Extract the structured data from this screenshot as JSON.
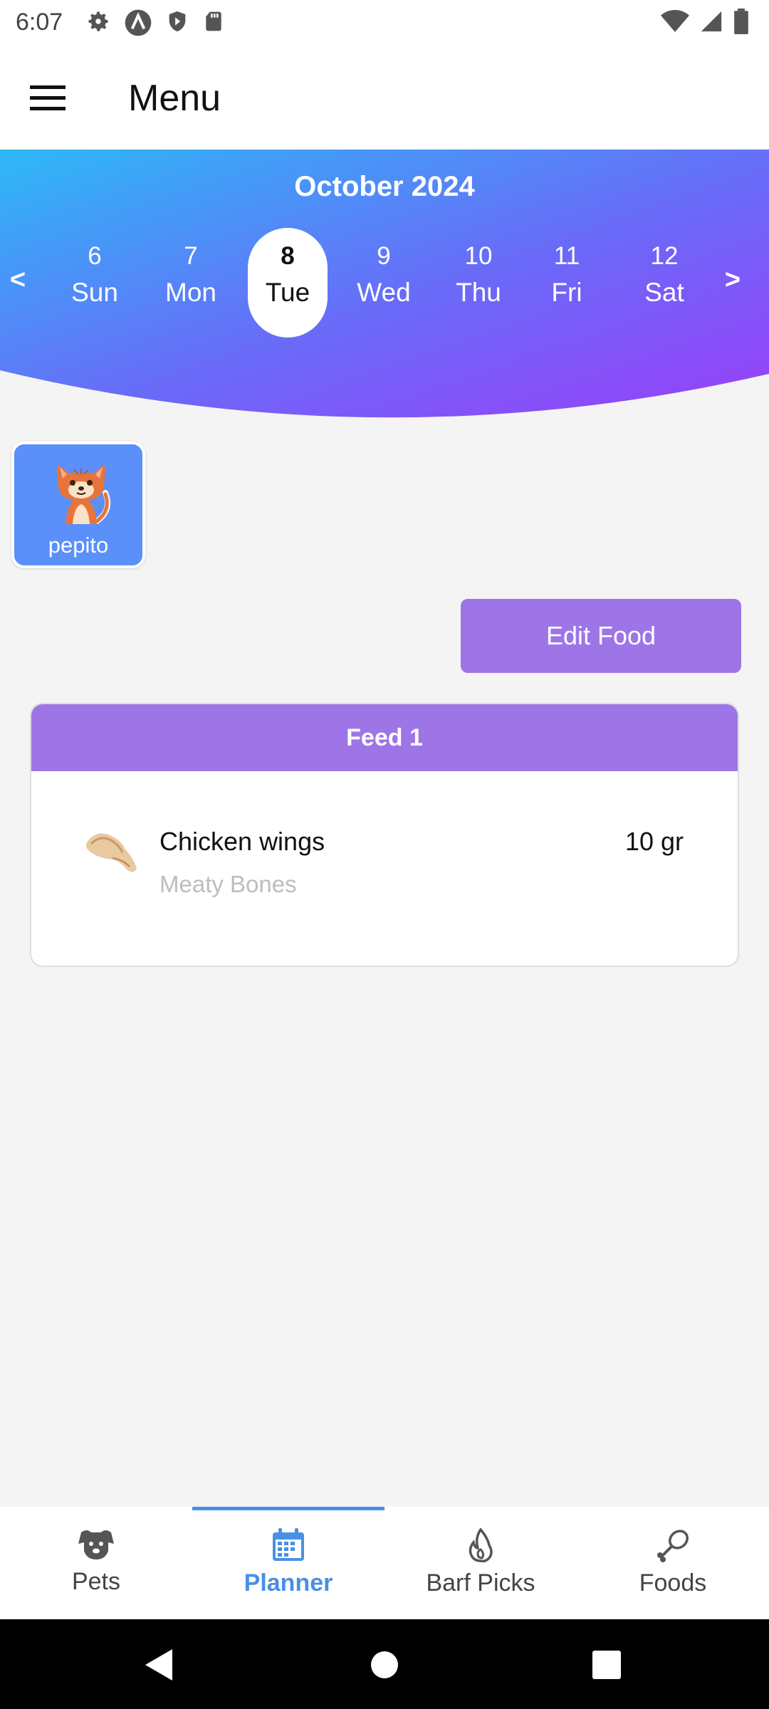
{
  "status_bar": {
    "time": "6:07",
    "left_icons": [
      "settings-icon",
      "a-badge-icon",
      "shield-icon",
      "sd-card-icon"
    ],
    "right_icons": [
      "wifi-icon",
      "signal-icon",
      "battery-icon"
    ]
  },
  "app_bar": {
    "title": "Menu",
    "menu_icon": "hamburger-icon"
  },
  "calendar": {
    "month_title": "October 2024",
    "prev_label": "<",
    "next_label": ">",
    "days": [
      {
        "num": "6",
        "name": "Sun",
        "selected": false
      },
      {
        "num": "7",
        "name": "Mon",
        "selected": false
      },
      {
        "num": "8",
        "name": "Tue",
        "selected": true
      },
      {
        "num": "9",
        "name": "Wed",
        "selected": false
      },
      {
        "num": "10",
        "name": "Thu",
        "selected": false
      },
      {
        "num": "11",
        "name": "Fri",
        "selected": false
      },
      {
        "num": "12",
        "name": "Sat",
        "selected": false
      }
    ],
    "gradient_start": "#2db9f7",
    "gradient_end": "#9a3ef9"
  },
  "pet": {
    "name": "pepito",
    "avatar": "cat-avatar-icon",
    "card_color": "#5b8ff9"
  },
  "actions": {
    "edit_food_label": "Edit Food",
    "accent": "#9e75e6"
  },
  "feed": {
    "title": "Feed 1",
    "items": [
      {
        "name": "Chicken wings",
        "category": "Meaty Bones",
        "quantity": "10 gr",
        "icon": "chicken-wing-icon"
      }
    ]
  },
  "bottom_nav": {
    "active_color": "#4a90e2",
    "tabs": [
      {
        "label": "Pets",
        "icon": "dog-face-icon",
        "active": false
      },
      {
        "label": "Planner",
        "icon": "calendar-icon",
        "active": true
      },
      {
        "label": "Barf Picks",
        "icon": "flame-icon",
        "active": false
      },
      {
        "label": "Foods",
        "icon": "drumstick-icon",
        "active": false
      }
    ]
  },
  "system_nav": [
    "back-icon",
    "home-icon",
    "recents-icon"
  ]
}
